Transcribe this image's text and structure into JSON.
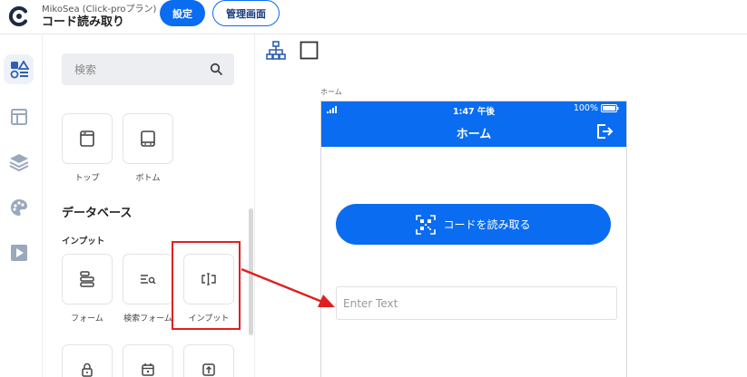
{
  "header": {
    "app_subtitle": "MikoSea (Click-proプラン)",
    "app_title": "コード読み取り",
    "settings_label": "設定",
    "admin_label": "管理画面"
  },
  "rail": {
    "icons": [
      "components-icon",
      "layout-icon",
      "layers-icon",
      "palette-icon",
      "preview-icon"
    ],
    "active": "components-icon"
  },
  "panel": {
    "search": {
      "placeholder": "検索"
    },
    "layout_tiles": [
      {
        "label": "トップ",
        "icon": "header-bar-icon"
      },
      {
        "label": "ボトム",
        "icon": "footer-bar-icon"
      }
    ],
    "database_title": "データベース",
    "input_section_title": "インプット",
    "input_tiles": [
      {
        "label": "フォーム",
        "icon": "form-icon"
      },
      {
        "label": "検索フォーム",
        "icon": "search-form-icon"
      },
      {
        "label": "インプット",
        "icon": "text-input-icon"
      }
    ],
    "more_tiles": [
      {
        "icon": "lock-icon"
      },
      {
        "icon": "calendar-icon"
      },
      {
        "icon": "upload-icon"
      }
    ]
  },
  "canvas": {
    "screen_label": "ホーム",
    "phone": {
      "status_time": "1:47 午後",
      "battery": "100%",
      "nav_title": "ホーム",
      "read_button_label": "コードを読み取る",
      "text_input_placeholder": "Enter Text"
    }
  },
  "colors": {
    "primary": "#0a6cf0",
    "highlight": "#e02020",
    "rail_icon": "#4a6fa8"
  }
}
